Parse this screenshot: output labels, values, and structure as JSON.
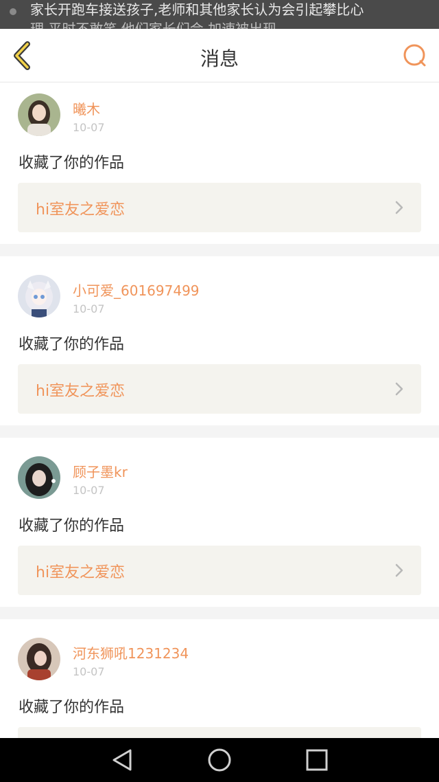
{
  "status_bar": {
    "notification_line1": "家长开跑车接送孩子,老师和其他家长认为会引起攀比心",
    "notification_line2": "理 平时不敢笑 他们家长们会 加速被出现"
  },
  "header": {
    "title": "消息",
    "back_icon": "chevron-left-icon",
    "search_icon": "search-icon",
    "accent_color": "#f0945a"
  },
  "messages": [
    {
      "username": "曦木",
      "date": "10-07",
      "action": "收藏了你的作品",
      "work_title": "hi室友之爱恋"
    },
    {
      "username": "小可爱_601697499",
      "date": "10-07",
      "action": "收藏了你的作品",
      "work_title": "hi室友之爱恋"
    },
    {
      "username": "顾子墨kr",
      "date": "10-07",
      "action": "收藏了你的作品",
      "work_title": "hi室友之爱恋"
    },
    {
      "username": "河东狮吼1231234",
      "date": "10-07",
      "action": "收藏了你的作品",
      "work_title": ""
    }
  ],
  "system_nav": {
    "back": "triangle-back-icon",
    "home": "circle-home-icon",
    "recents": "square-recents-icon"
  }
}
